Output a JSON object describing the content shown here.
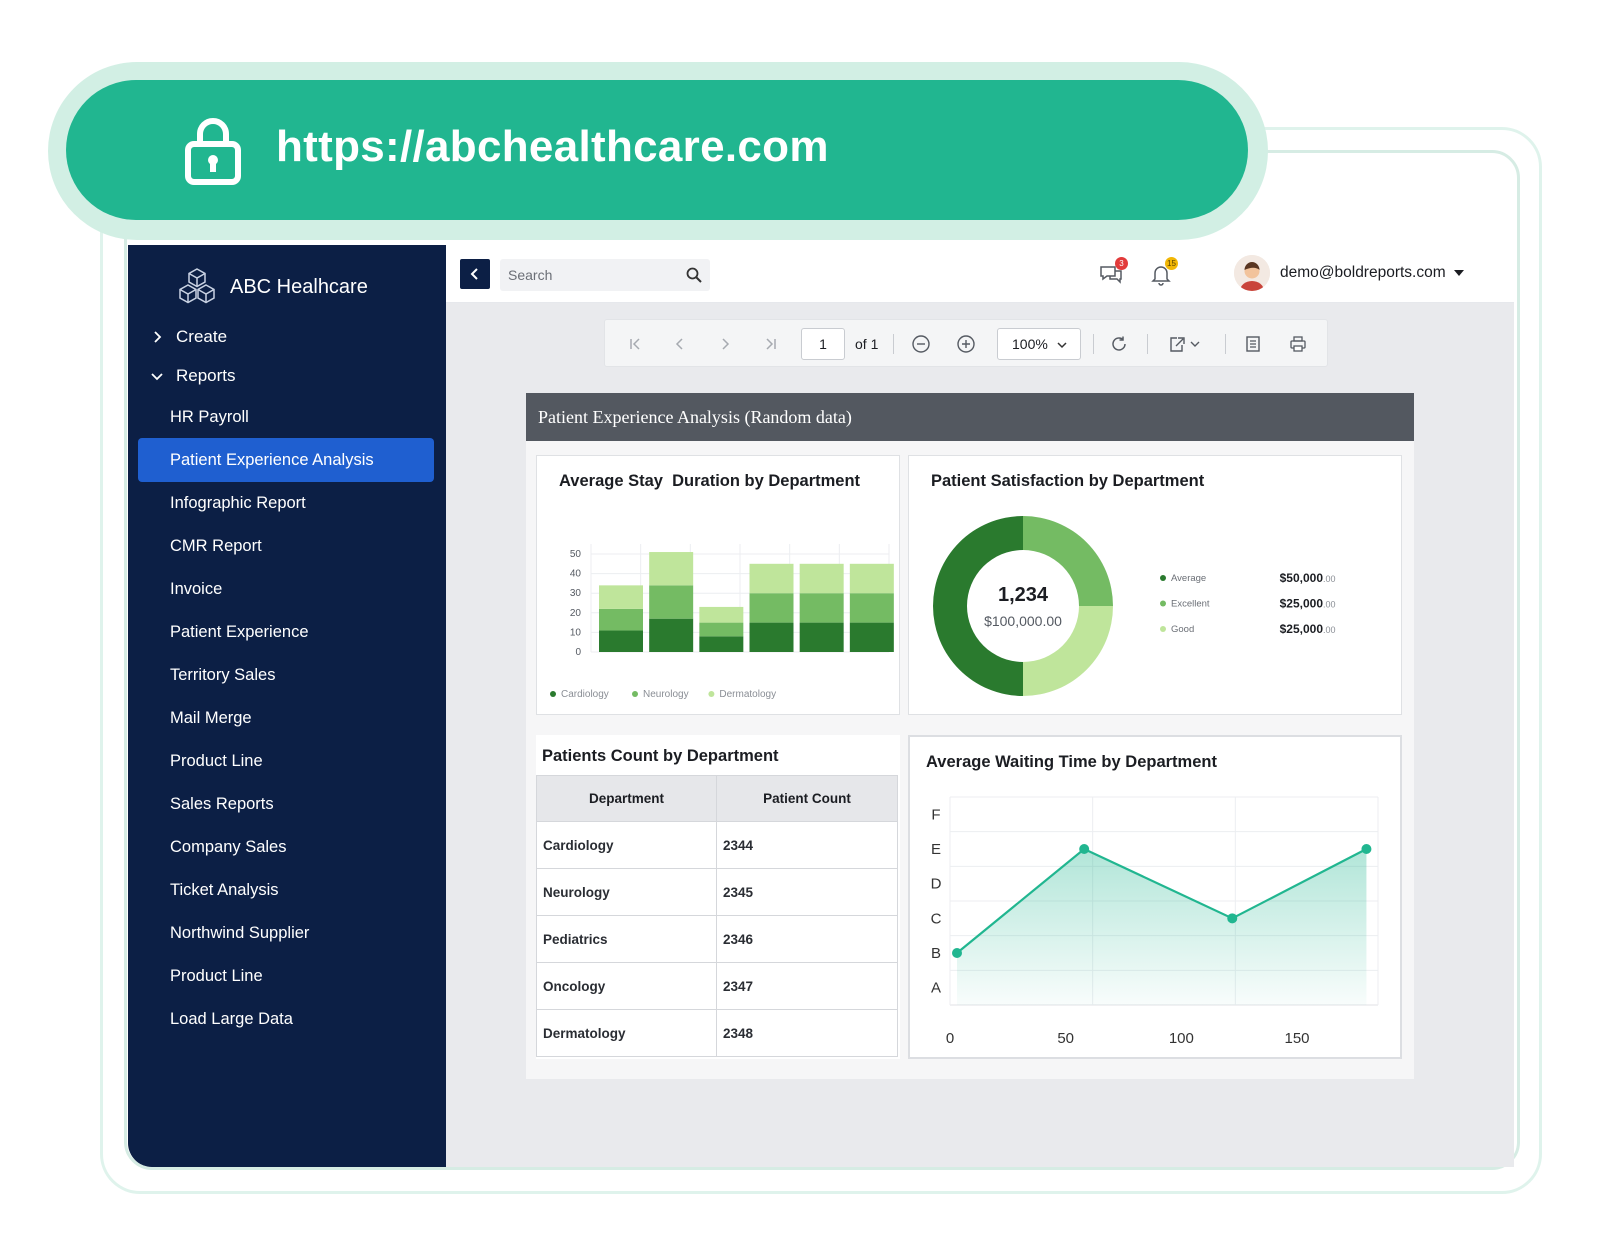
{
  "url_bar": {
    "url": "https://abchealthcare.com",
    "icon": "lock-icon"
  },
  "brand": {
    "name": "ABC Healhcare",
    "icon": "cubes-icon"
  },
  "sidebar": {
    "groups": [
      {
        "label": "Create",
        "expanded": false
      },
      {
        "label": "Reports",
        "expanded": true
      }
    ],
    "items": [
      {
        "label": "HR Payroll"
      },
      {
        "label": "Patient Experience Analysis",
        "active": true
      },
      {
        "label": "Infographic Report"
      },
      {
        "label": "CMR Report"
      },
      {
        "label": "Invoice"
      },
      {
        "label": "Patient Experience"
      },
      {
        "label": "Territory Sales"
      },
      {
        "label": "Mail Merge"
      },
      {
        "label": "Product Line"
      },
      {
        "label": "Sales Reports"
      },
      {
        "label": "Company Sales"
      },
      {
        "label": "Ticket Analysis"
      },
      {
        "label": "Northwind Supplier"
      },
      {
        "label": "Product Line"
      },
      {
        "label": "Load Large Data"
      }
    ]
  },
  "topbar": {
    "search_placeholder": "Search",
    "messages_badge": "3",
    "notifications_badge": "15",
    "user_email": "demo@boldreports.com"
  },
  "viewer_toolbar": {
    "page": "1",
    "page_of": "of 1",
    "zoom": "100%"
  },
  "report": {
    "title": "Patient Experience Analysis (Random data)",
    "stay_chart_title": "Average Stay  Duration by Department",
    "satisfaction_title": "Patient Satisfaction by Department",
    "donut_center_value": "1,234",
    "donut_center_sub": "$100,000.00",
    "satisfaction_legend": [
      {
        "label": "Average",
        "amount": "$50,000",
        "cents": ".00",
        "color": "#2a7a2e"
      },
      {
        "label": "Excellent",
        "amount": "$25,000",
        "cents": ".00",
        "color": "#74bb63"
      },
      {
        "label": "Good",
        "amount": "$25,000",
        "cents": ".00",
        "color": "#bfe59b"
      }
    ],
    "patients_count_title": "Patients Count by Department",
    "table_headers": [
      "Department",
      "Patient Count"
    ],
    "table_rows": [
      [
        "Cardiology",
        "2344"
      ],
      [
        "Neurology",
        "2345"
      ],
      [
        "Pediatrics",
        "2346"
      ],
      [
        "Oncology",
        "2347"
      ],
      [
        "Dermatology",
        "2348"
      ]
    ],
    "waiting_title": "Average Waiting Time by Department"
  },
  "colors": {
    "accent": "#21b690",
    "sidebar": "#0c1f45",
    "active": "#1f5fd0",
    "dark_green": "#2a7a2e",
    "mid_green": "#74bb63",
    "light_green": "#bfe59b"
  },
  "chart_data": [
    {
      "type": "bar",
      "stacked": true,
      "title": "Average Stay  Duration by Department",
      "categories": [
        "",
        "",
        "",
        "",
        "",
        ""
      ],
      "series": [
        {
          "name": "Cardiology",
          "values": [
            11,
            17,
            8,
            15,
            15,
            15
          ],
          "color": "#2a7a2e"
        },
        {
          "name": "Neurology",
          "values": [
            11,
            17,
            7,
            15,
            15,
            15
          ],
          "color": "#74bb63"
        },
        {
          "name": "Dermatology",
          "values": [
            12,
            17,
            8,
            15,
            15,
            15
          ],
          "color": "#bfe59b"
        }
      ],
      "ylim": [
        0,
        50
      ],
      "yticks": [
        0,
        10,
        20,
        30,
        40,
        50
      ],
      "grid": true,
      "legend": "bottom-left"
    },
    {
      "type": "pie",
      "donut": true,
      "title": "Patient Satisfaction by Department",
      "labels": [
        "Average",
        "Excellent",
        "Good"
      ],
      "values": [
        50000,
        25000,
        25000
      ],
      "colors": [
        "#2a7a2e",
        "#74bb63",
        "#bfe59b"
      ],
      "legend": "right"
    },
    {
      "type": "area",
      "title": "Average Waiting Time by Department",
      "x": [
        0,
        58,
        122,
        180
      ],
      "y": [
        "B",
        "E",
        "C",
        "E"
      ],
      "xticks": [
        0,
        50,
        100,
        150
      ],
      "yticks": [
        "A",
        "B",
        "C",
        "D",
        "E",
        "F"
      ],
      "xlim": [
        0,
        185
      ],
      "grid": true,
      "color": "#21b690"
    }
  ]
}
